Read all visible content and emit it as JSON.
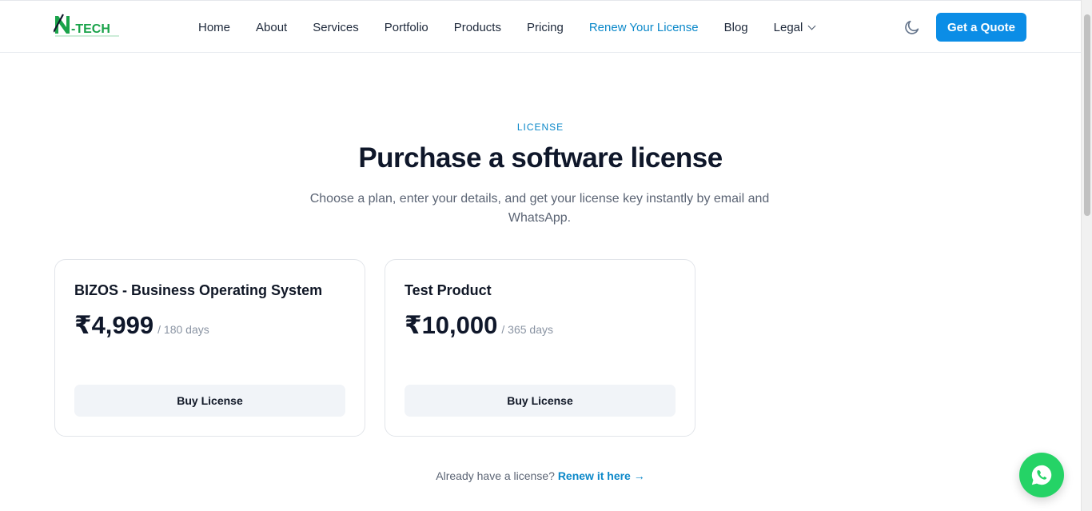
{
  "brand": {
    "logo_text": "-TECH",
    "accent": "#1aa34a"
  },
  "nav": {
    "items": [
      {
        "label": "Home"
      },
      {
        "label": "About"
      },
      {
        "label": "Services"
      },
      {
        "label": "Portfolio"
      },
      {
        "label": "Products"
      },
      {
        "label": "Pricing"
      },
      {
        "label": "Renew Your License",
        "active": true
      },
      {
        "label": "Blog"
      },
      {
        "label": "Legal",
        "has_dropdown": true
      }
    ],
    "theme_toggle_icon": "moon-icon",
    "cta_label": "Get a Quote",
    "cta_color": "#0b8de6",
    "active_color": "#0b88c9"
  },
  "hero": {
    "eyebrow": "LICENSE",
    "title": "Purchase a software license",
    "subtitle": "Choose a plan, enter your details, and get your license key instantly by email and WhatsApp."
  },
  "plans": [
    {
      "name": "BIZOS - Business Operating System",
      "price": "₹4,999",
      "period": "/ 180 days",
      "button_label": "Buy License"
    },
    {
      "name": "Test Product",
      "price": "₹10,000",
      "period": "/ 365 days",
      "button_label": "Buy License"
    }
  ],
  "renew": {
    "prefix": "Already have a license?",
    "link_label": "Renew it here →"
  },
  "floating": {
    "whatsapp_icon": "whatsapp-icon",
    "color": "#25d366"
  }
}
